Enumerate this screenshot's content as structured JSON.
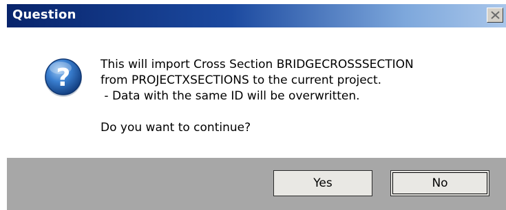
{
  "window": {
    "title": "Question",
    "close_icon": "close-icon"
  },
  "content": {
    "icon": "question-icon",
    "icon_glyph": "?",
    "message_lines": [
      "This will import Cross Section BRIDGECROSSSECTION",
      "from PROJECTXSECTIONS to the current project.",
      " - Data with the same ID will be overwritten."
    ],
    "prompt": "Do you want to continue?"
  },
  "buttons": {
    "yes_label": "Yes",
    "no_label": "No"
  },
  "colors": {
    "title_gradient_start": "#08246b",
    "title_gradient_end": "#a9c6ea",
    "footer_bg": "#a7a7a7",
    "icon_blue": "#1f5ea8"
  }
}
